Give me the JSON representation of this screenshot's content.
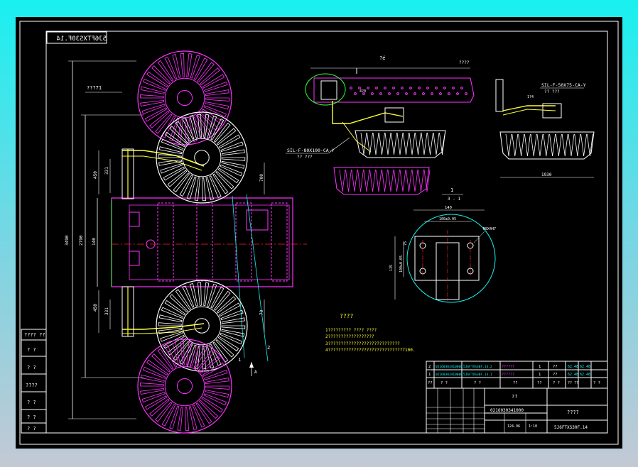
{
  "drawing": {
    "number_mirrored": "5J6FTXS30F.14",
    "title_block_left_labels": [
      "???? ??",
      "? ?",
      "? ?",
      "????",
      "? ?",
      "? ?",
      "? ?"
    ],
    "label_front_top": "???71",
    "label_front_view_top": "?é",
    "label_top_right_ruler": "????",
    "callout_a": "SIL-F-80X100-CA-Y",
    "callout_a_sub": "?? ???",
    "callout_b": "SIL-F-50X75-CA-Y",
    "callout_b_sub": "?? ???",
    "section_label": "1",
    "section_sub": "3 - 1",
    "hole_callout": "M8X4H7",
    "dim_bottom_right": "1930",
    "dim_left_total": "3490",
    "dim_left_inner": "2790",
    "dim_left_mid": "140",
    "dim_upper_arm": "450",
    "dim_upper_small": "331",
    "dim_lower_arm": "450",
    "dim_lower_small": "331",
    "dim_right_a": "700",
    "dim_right_b": "70",
    "dim_section_w": "140",
    "dim_section_w2": "100±0.05",
    "dim_section_h": "75",
    "dim_section_h2": "100±0.05",
    "dim_section_h3": "135",
    "arrow_a": "A",
    "leader_1": "1",
    "leader_2": "2",
    "notes_title": "????",
    "notes": [
      "1????????? ???? ????",
      "2??????????????????",
      "3????????????????????????????",
      "4?????????????????????????????7100."
    ],
    "bom_rows": [
      {
        "no": "2",
        "code": "0216030341000B",
        "name": "5J6FTXS30F.14.2",
        "desc": "??????",
        "qty": "1",
        "mat": "??",
        "w1": "62.48",
        "w2": "62.48"
      },
      {
        "no": "1",
        "code": "0216030341000B",
        "name": "5J6FTXS30F.14.1",
        "desc": "??????",
        "qty": "1",
        "mat": "??",
        "w1": "62.48",
        "w2": "62.48"
      }
    ],
    "bom_header": [
      "??",
      "?  ?",
      "?  ?",
      "??",
      "??",
      "?  ?",
      "?? ??",
      "? ?"
    ],
    "title_center": "??",
    "title_code": "0216030341000",
    "title_name": "????",
    "title_drawing_no": "5J6FTXS30F.14",
    "title_scale": "1:10",
    "title_weight": "124.96",
    "colors": {
      "background": "#000000",
      "outer_bg": "#19f0f0",
      "white_lines": "#ffffff",
      "magenta": "#ff33ff",
      "cyan": "#19f0f0",
      "yellow": "#ffff33",
      "green": "#33ff33",
      "red": "#ff2222"
    }
  }
}
